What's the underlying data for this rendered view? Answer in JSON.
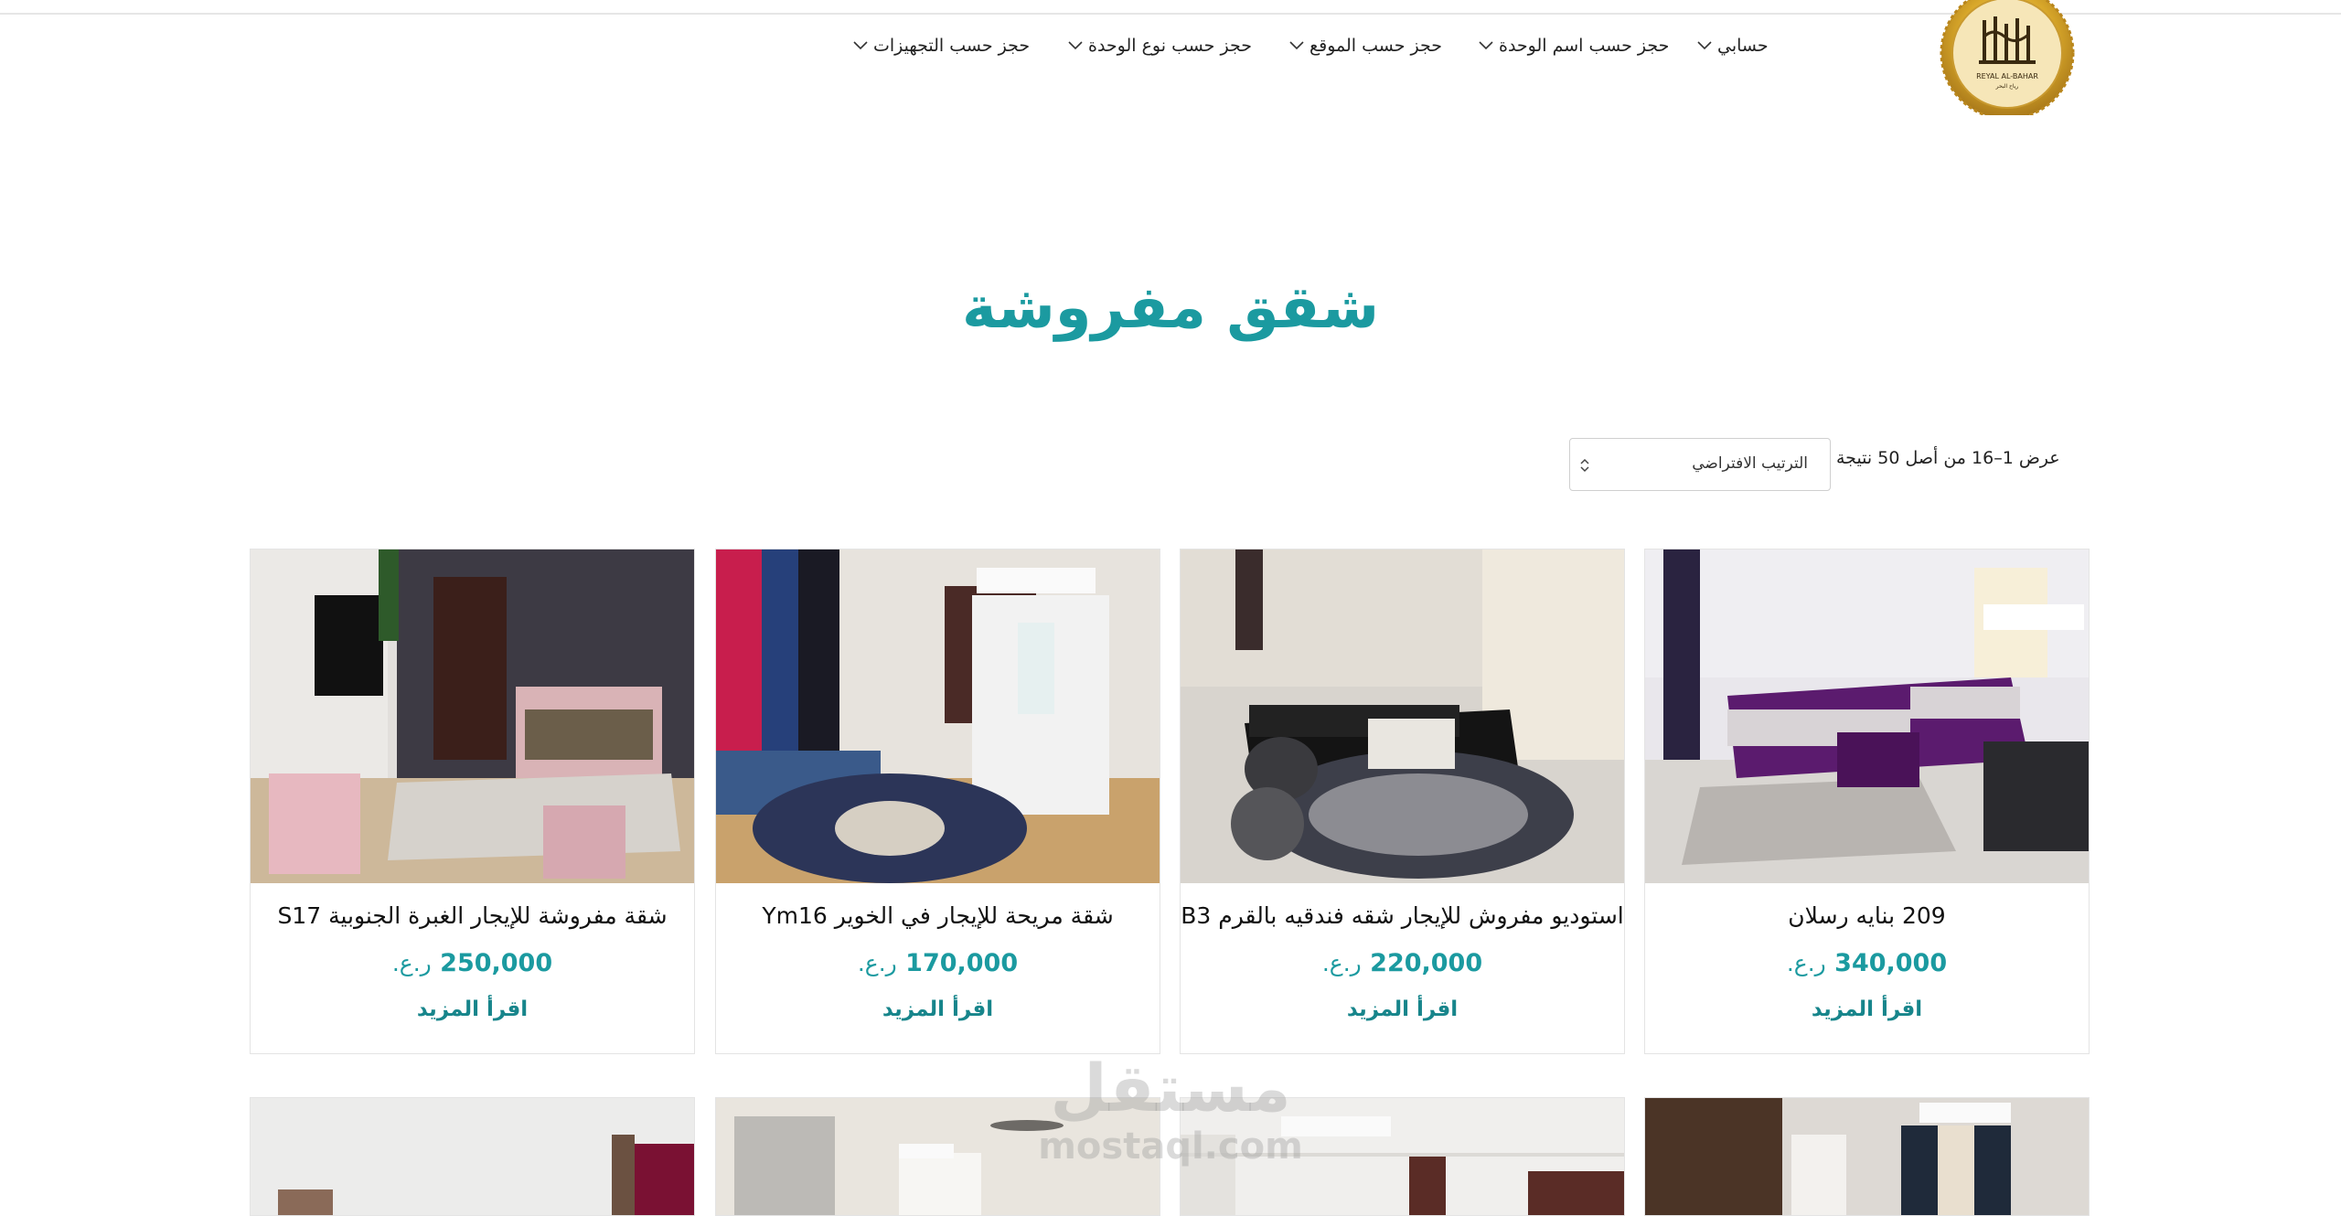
{
  "logo": {
    "arabic": "رياح البحر",
    "latin": "REYAL AL-BAHAR"
  },
  "nav": [
    {
      "label": "حسابي"
    },
    {
      "label": "حجز حسب اسم الوحدة"
    },
    {
      "label": "حجز حسب الموقع"
    },
    {
      "label": "حجز حسب نوع الوحدة"
    },
    {
      "label": "حجز حسب التجهيزات"
    }
  ],
  "page_title": "شقق مفروشة",
  "result_count": "عرض 1–16 من أصل 50 نتيجة",
  "sort": {
    "selected": "الترتيب الافتراضي"
  },
  "products": [
    {
      "title": "209 بنايه رسلان",
      "price": "340,000",
      "currency": "ر.ع.",
      "more": "اقرأ المزيد"
    },
    {
      "title": "استوديو مفروش للإيجار شقه فندقيه بالقرم B3",
      "price": "220,000",
      "currency": "ر.ع.",
      "more": "اقرأ المزيد"
    },
    {
      "title": "شقة مريحة للإيجار في الخوير Ym16",
      "price": "170,000",
      "currency": "ر.ع.",
      "more": "اقرأ المزيد"
    },
    {
      "title": "شقة مفروشة للإيجار الغبرة الجنوبية S17",
      "price": "250,000",
      "currency": "ر.ع.",
      "more": "اقرأ المزيد"
    }
  ],
  "watermark": {
    "arabic": "مستقل",
    "latin": "mostaql.com"
  },
  "colors": {
    "accent": "#1b9aa0",
    "gold": "#d9a82a"
  }
}
